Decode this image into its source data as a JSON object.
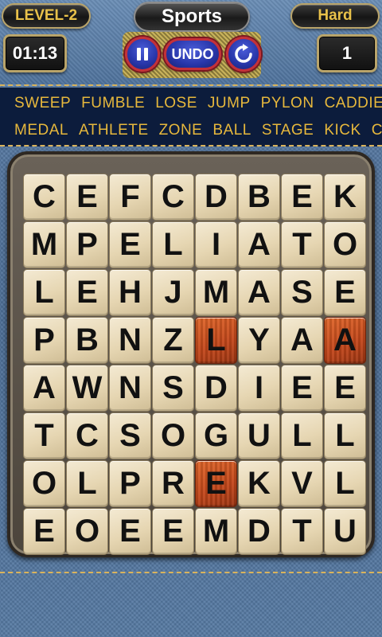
{
  "header": {
    "level": "LEVEL-2",
    "category": "Sports",
    "difficulty": "Hard",
    "timer": "01:13",
    "score": "1",
    "undo_label": "UNDO"
  },
  "words": {
    "row1": [
      "SWEEP",
      "FUMBLE",
      "LOSE",
      "JUMP",
      "PYLON",
      "CADDIE"
    ],
    "row2": [
      "MEDAL",
      "ATHLETE",
      "ZONE",
      "BALL",
      "STAGE",
      "KICK",
      "CO"
    ]
  },
  "grid": [
    [
      "C",
      "E",
      "F",
      "C",
      "D",
      "B",
      "E",
      "K"
    ],
    [
      "M",
      "P",
      "E",
      "L",
      "I",
      "A",
      "T",
      "O"
    ],
    [
      "L",
      "E",
      "H",
      "J",
      "M",
      "A",
      "S",
      "E"
    ],
    [
      "P",
      "B",
      "N",
      "Z",
      "L",
      "Y",
      "A",
      "A"
    ],
    [
      "A",
      "W",
      "N",
      "S",
      "D",
      "I",
      "E",
      "E"
    ],
    [
      "T",
      "C",
      "S",
      "O",
      "G",
      "U",
      "L",
      "L"
    ],
    [
      "O",
      "L",
      "P",
      "R",
      "E",
      "K",
      "V",
      "L"
    ],
    [
      "E",
      "O",
      "E",
      "E",
      "M",
      "D",
      "T",
      "U"
    ]
  ],
  "selected_cells": [
    [
      3,
      4
    ],
    [
      3,
      7
    ],
    [
      6,
      4
    ]
  ],
  "colors": {
    "accent_gold": "#e7b83c",
    "selected_tile": "#c2461a",
    "button_blue": "#2735a8",
    "button_ring": "#c4303a"
  },
  "icons": {
    "pause": "pause-icon",
    "restart": "restart-icon"
  }
}
